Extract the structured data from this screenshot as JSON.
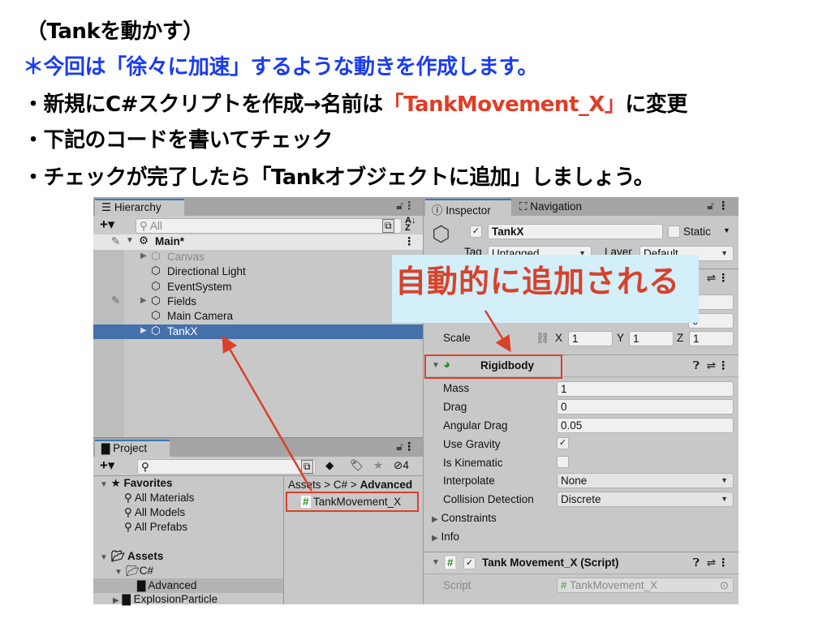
{
  "slide": {
    "title": "（Tankを動かす）",
    "note": "＊今回は「徐々に加速」するような動きを作成します。",
    "bullet1_prefix": "・新規にC#スクリプトを作成→名前は",
    "bullet1_highlight": "「TankMovement_X」",
    "bullet1_suffix": "に変更",
    "bullet2": "・下記のコードを書いてチェック",
    "bullet3": "・チェックが完了したら「Tankオブジェクトに追加」しましょう。",
    "callout": "自動的に追加される",
    "colors": {
      "note": "#1a3cf0",
      "highlight": "#e23c24",
      "callout_text": "#d9412b",
      "callout_bg": "#d2effa"
    }
  },
  "hierarchy": {
    "tab": "Hierarchy",
    "search_placeholder": "All",
    "scene": "Main*",
    "items": [
      {
        "label": "Canvas",
        "expandable": true,
        "dimmed": true
      },
      {
        "label": "Directional Light",
        "expandable": false
      },
      {
        "label": "EventSystem",
        "expandable": false
      },
      {
        "label": "Fields",
        "expandable": true
      },
      {
        "label": "Main Camera",
        "expandable": false
      },
      {
        "label": "TankX",
        "expandable": true,
        "selected": true
      }
    ]
  },
  "project": {
    "tab": "Project",
    "hidden_count": "4",
    "favorites": {
      "label": "Favorites",
      "items": [
        "All Materials",
        "All Models",
        "All Prefabs"
      ]
    },
    "assets": {
      "label": "Assets",
      "items": [
        "C#",
        "Advanced",
        "ExplosionParticle"
      ]
    },
    "breadcrumb": [
      "Assets",
      "C#",
      "Advanced"
    ],
    "files": [
      "TankMovement_X"
    ]
  },
  "inspector": {
    "tabs": [
      "Inspector",
      "Navigation"
    ],
    "object_name": "TankX",
    "active": true,
    "static_label": "Static",
    "tag_label": "Tag",
    "tag_value": "Untagged",
    "layer_label": "Layer",
    "layer_value": "Default",
    "transform": {
      "position_z": "0",
      "rotation_z": "0",
      "scale_label": "Scale",
      "scale": {
        "x": "1",
        "y": "1",
        "z": "1"
      },
      "axis_labels": [
        "X",
        "Y",
        "Z"
      ]
    },
    "rigidbody": {
      "title": "Rigidbody",
      "mass_label": "Mass",
      "mass": "1",
      "drag_label": "Drag",
      "drag": "0",
      "angular_drag_label": "Angular Drag",
      "angular_drag": "0.05",
      "use_gravity_label": "Use Gravity",
      "use_gravity": true,
      "is_kinematic_label": "Is Kinematic",
      "is_kinematic": false,
      "interpolate_label": "Interpolate",
      "interpolate": "None",
      "collision_label": "Collision Detection",
      "collision": "Discrete",
      "constraints_label": "Constraints",
      "info_label": "Info"
    },
    "script_component": {
      "title": "Tank Movement_X (Script)",
      "enabled": true,
      "script_label": "Script",
      "script_value": "TankMovement_X"
    }
  }
}
